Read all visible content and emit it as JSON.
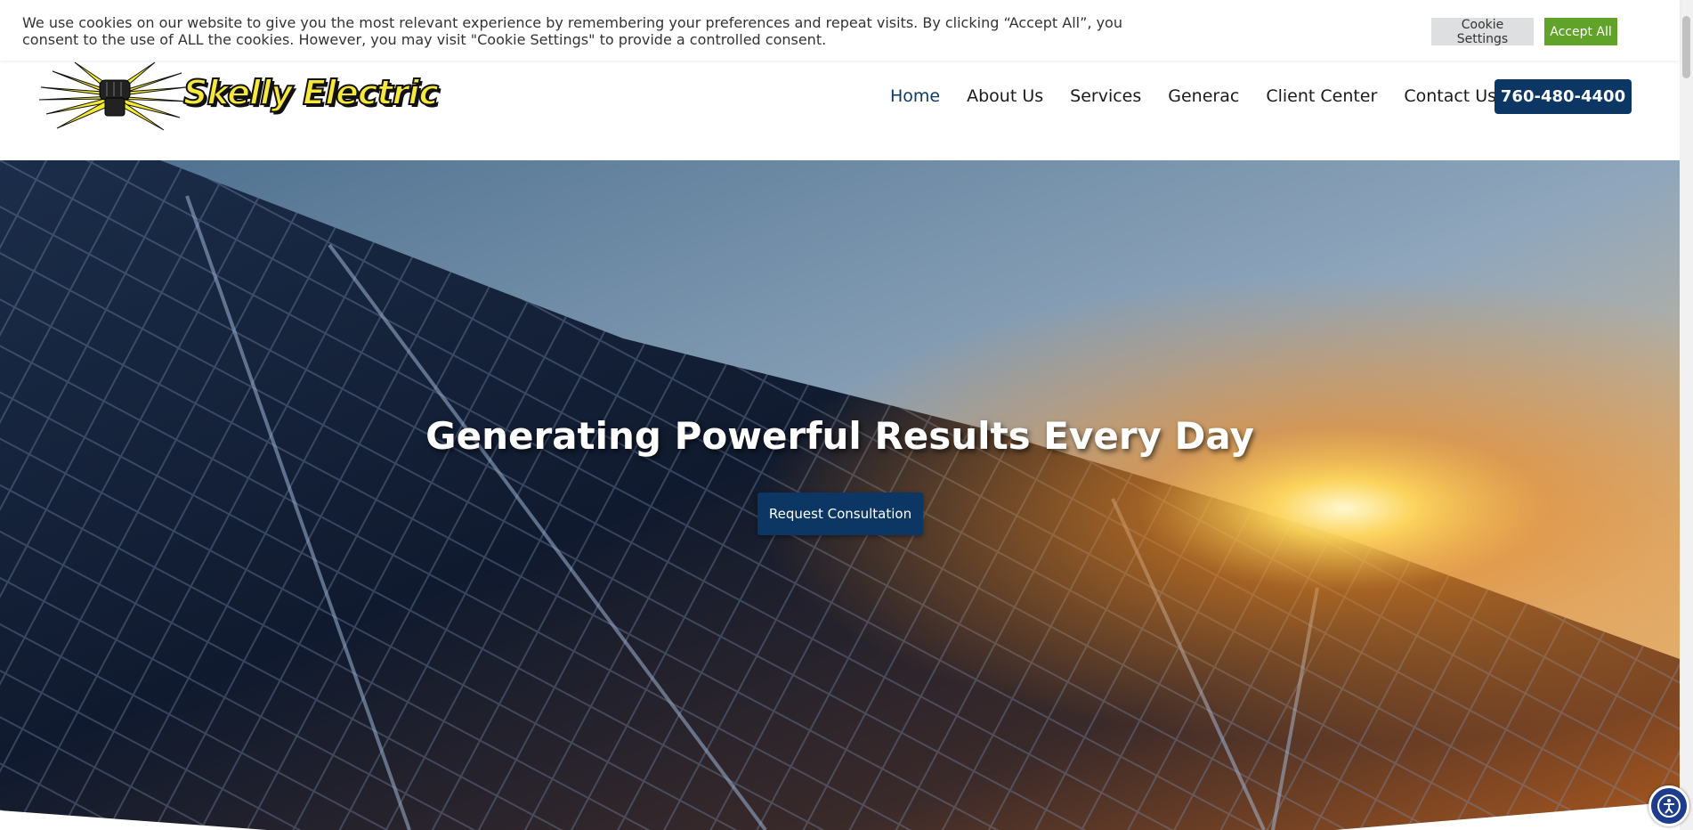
{
  "cookie_banner": {
    "message": "We use cookies on our website to give you the most relevant experience by remembering your preferences and repeat visits. By clicking “Accept All”, you consent to the use of ALL the cookies. However, you may visit \"Cookie Settings\" to provide a controlled consent.",
    "settings_label": "Cookie Settings",
    "accept_label": "Accept All",
    "accept_color": "#61a229"
  },
  "header": {
    "logo_text": "Skelly Electric",
    "nav": [
      {
        "label": "Home",
        "active": true
      },
      {
        "label": "About Us"
      },
      {
        "label": "Services"
      },
      {
        "label": "Generac"
      },
      {
        "label": "Client Center"
      },
      {
        "label": "Contact Us"
      }
    ],
    "phone": "760-480-4400",
    "brand_color": "#0c3765"
  },
  "hero": {
    "title": "Generating Powerful Results Every Day",
    "cta_label": "Request Consultation",
    "background": "solar-panels-sunset-image"
  },
  "accessibility": {
    "icon": "accessibility-icon"
  }
}
